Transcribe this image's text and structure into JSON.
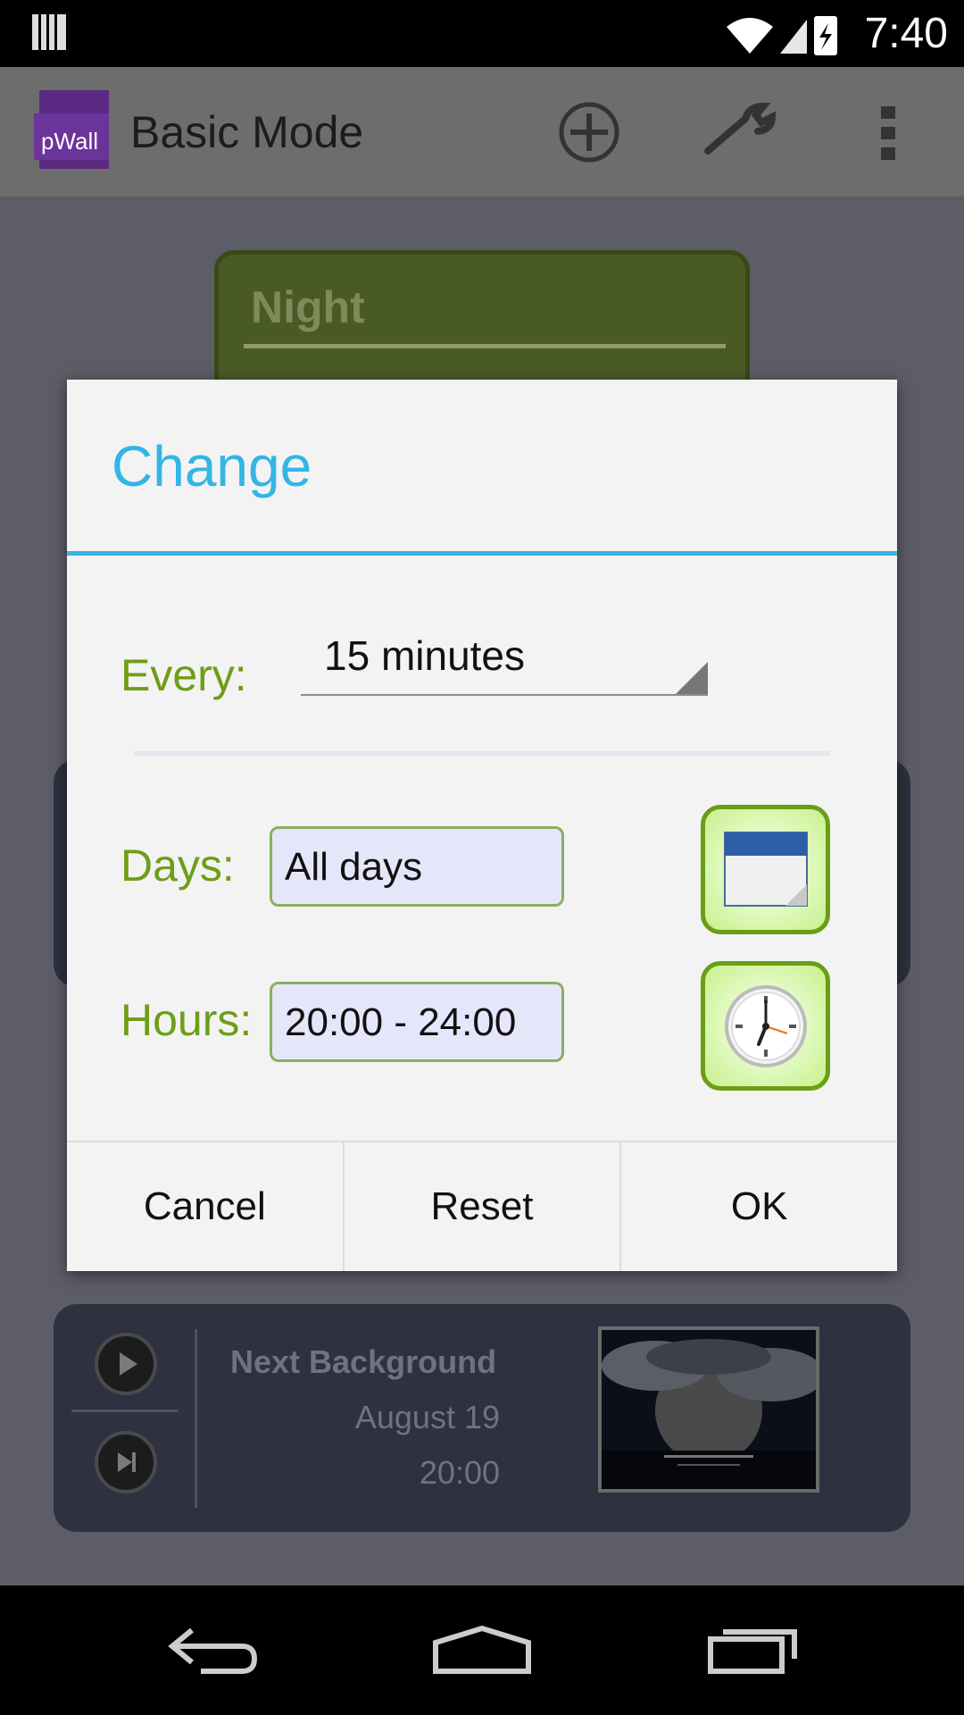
{
  "status_bar": {
    "time": "7:40"
  },
  "action_bar": {
    "logo_text": "pWall",
    "title": "Basic Mode",
    "icons": [
      "add-circle-icon",
      "wrench-icon",
      "overflow-menu-icon"
    ]
  },
  "background": {
    "profile_card_title": "Night",
    "next_background": {
      "title": "Next Background",
      "date": "August 19",
      "time": "20:00"
    }
  },
  "dialog": {
    "title": "Change",
    "every_label": "Every:",
    "every_value": "15 minutes",
    "days_label": "Days:",
    "days_value": "All days",
    "hours_label": "Hours:",
    "hours_value": "20:00 - 24:00",
    "buttons": {
      "cancel": "Cancel",
      "reset": "Reset",
      "ok": "OK"
    }
  },
  "colors": {
    "accent": "#33b5e5",
    "label_green": "#6d9e16",
    "field_bg": "#e6e6fa"
  }
}
